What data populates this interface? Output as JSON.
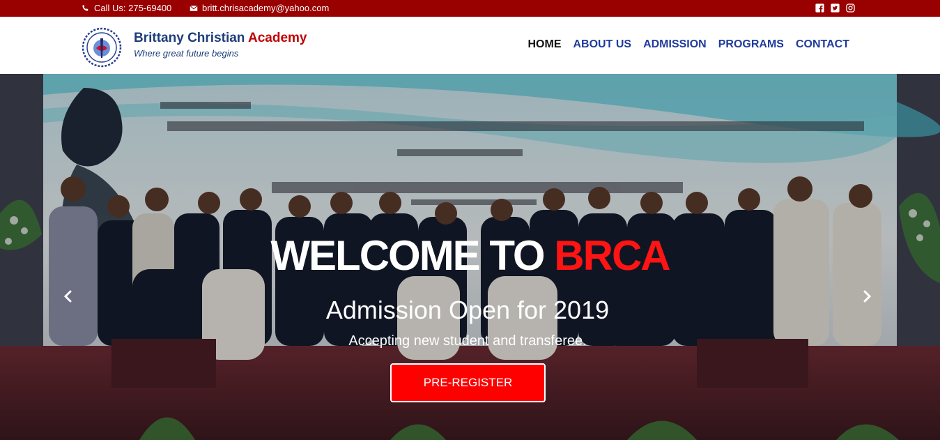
{
  "topbar": {
    "phone": "Call Us: 275-69400",
    "email": "britt.chrisacademy@yahoo.com",
    "social": [
      "facebook-icon",
      "twitter-icon",
      "instagram-icon"
    ]
  },
  "header": {
    "brand_main": "Brittany Christian ",
    "brand_accent": "Academy",
    "tagline": "Where great future begins"
  },
  "nav": {
    "items": [
      "HOME",
      "ABOUT US",
      "ADMISSION",
      "PROGRAMS",
      "CONTACT"
    ],
    "active": "HOME"
  },
  "hero": {
    "title_white": "WELCOME TO ",
    "title_red": "BRCA",
    "subtitle": "Admission Open for 2019",
    "description": "Accepting new student and transferee.",
    "button": "PRE-REGISTER"
  },
  "colors": {
    "topbar_bg": "#990000",
    "brand_blue": "#1f3d7a",
    "nav_blue": "#1f3b9c",
    "accent_red": "#ff1414"
  }
}
